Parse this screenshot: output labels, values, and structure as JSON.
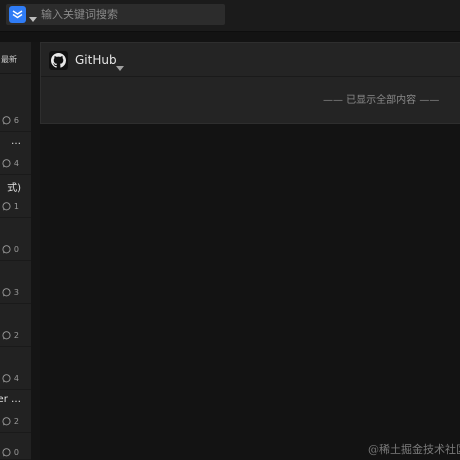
{
  "search": {
    "placeholder": "输入关键词搜索",
    "logo_icon": "layers-down-icon",
    "caret_icon": "caret-down-icon"
  },
  "sidebar": {
    "sort_label": "最新",
    "items": [
      {
        "title": "",
        "comments": "6"
      },
      {
        "title": "…",
        "comments": "4"
      },
      {
        "title": "式)",
        "comments": "1"
      },
      {
        "title": "",
        "comments": "0"
      },
      {
        "title": "",
        "comments": "3"
      },
      {
        "title": "",
        "comments": "2"
      },
      {
        "title": "",
        "comments": "4"
      },
      {
        "title": "er …",
        "comments": "2"
      },
      {
        "title": "",
        "comments": "0"
      }
    ]
  },
  "panel": {
    "source_name": "GitHub",
    "source_icon": "github-icon",
    "end_note": "—— 已显示全部内容 ——"
  },
  "watermark": "@稀土掘金技术社区",
  "colors": {
    "accent": "#2f7cf6",
    "background": "#131313",
    "panel": "#242424",
    "sidebar": "#222222"
  }
}
